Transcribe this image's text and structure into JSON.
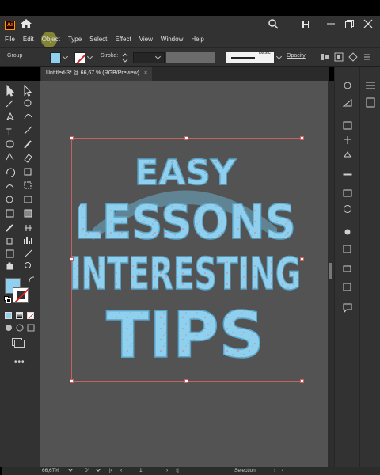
{
  "app": {
    "logo_text": "Ai",
    "accent": "#ff9a00"
  },
  "menu": {
    "items": [
      "File",
      "Edit",
      "Object",
      "Type",
      "Select",
      "Effect",
      "View",
      "Window",
      "Help"
    ],
    "active": "Object"
  },
  "control_bar": {
    "selection_type": "Group",
    "fill_color": "#8fd0ef",
    "stroke_label": "Stroke:",
    "brush_label": "Basic",
    "opacity_label": "Opacity"
  },
  "document_tab": {
    "title": "Untitled-3* @ 66,67 % (RGB/Preview)",
    "close": "×"
  },
  "artwork": {
    "lines": [
      "EASY",
      "LESSONS",
      "INTERESTING",
      "TIPS"
    ],
    "fill": "#8fd0ef",
    "speckle": "#e07070"
  },
  "status_bar": {
    "zoom": "66,67%",
    "rotation": "0°",
    "artboard": "1",
    "tool": "Selection"
  },
  "icons": {
    "home": "home-icon",
    "search": "search-icon",
    "arrange": "arrange-documents-icon",
    "minimize": "minimize-icon",
    "maximize": "maximize-icon",
    "close": "close-icon"
  }
}
